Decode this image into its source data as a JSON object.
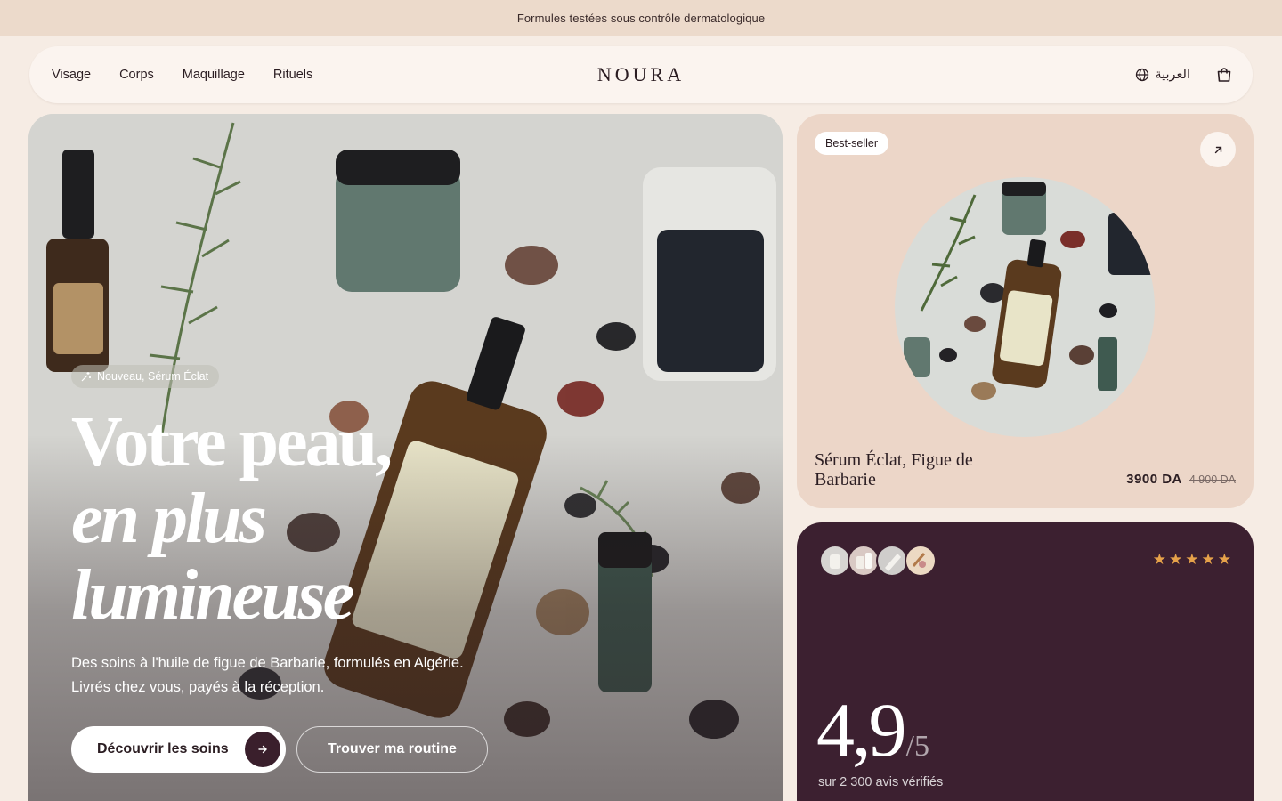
{
  "announcement": "Formules testées sous contrôle dermatologique",
  "nav": {
    "links": [
      "Visage",
      "Corps",
      "Maquillage",
      "Rituels"
    ],
    "brand": "NOURA",
    "language": "العربية"
  },
  "hero": {
    "badge": "Nouveau, Sérum Éclat",
    "title_line1": "Votre peau,",
    "title_line2": "en plus",
    "title_line3": "lumineuse",
    "subtitle": "Des soins à l'huile de figue de Barbarie, formulés en Algérie. Livrés chez vous, payés à la réception.",
    "primary_cta": "Découvrir les soins",
    "secondary_cta": "Trouver ma routine"
  },
  "product": {
    "badge": "Best-seller",
    "name": "Sérum Éclat, Figue de Barbarie",
    "price": "3900 DA",
    "old_price": "4 900 DA"
  },
  "rating": {
    "stars": 5,
    "score": "4,9",
    "out_of": "/5",
    "reviews": "sur 2 300 avis vérifiés"
  },
  "colors": {
    "announcement_bg": "#ecdacb",
    "page_bg": "#f6ece4",
    "product_card_bg": "#ecd6c8",
    "rating_card_bg": "#3c2030",
    "star": "#e6a24a",
    "accent": "#3a1f2c"
  }
}
